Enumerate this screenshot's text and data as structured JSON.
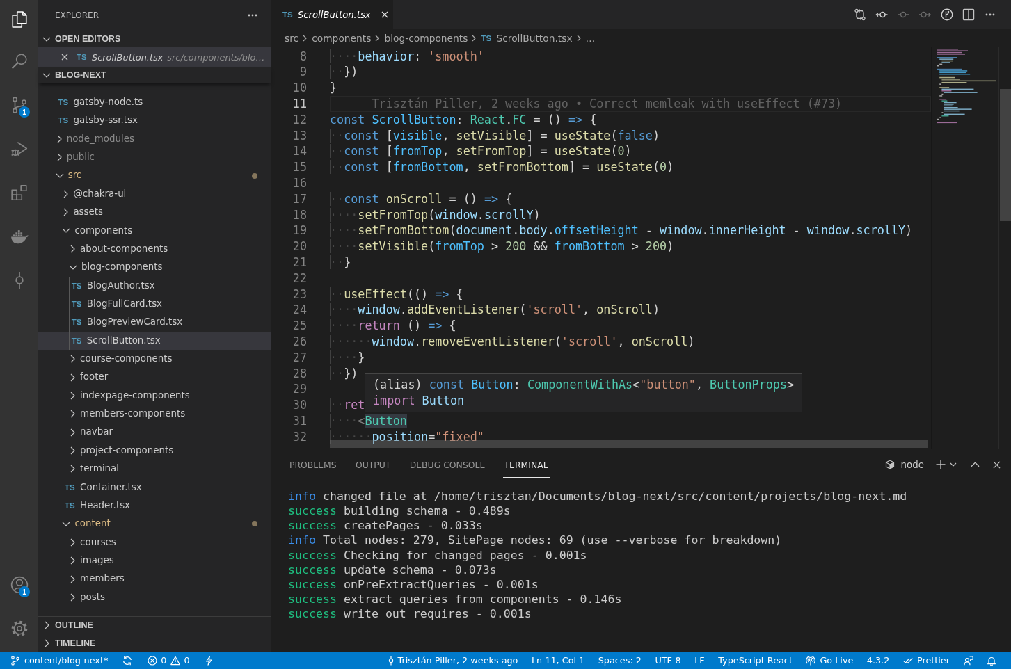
{
  "activity_bar": {
    "items": [
      {
        "selected": true
      },
      {
        "selected": false
      },
      {
        "selected": false,
        "badge": "1"
      },
      {
        "selected": false
      },
      {
        "selected": false
      },
      {
        "selected": false
      },
      {
        "selected": false
      }
    ],
    "accounts_badge": "1"
  },
  "sidebar": {
    "title": "EXPLORER",
    "open_editors": {
      "title": "OPEN EDITORS",
      "expanded": true,
      "items": [
        {
          "file_type": "TS",
          "name": "ScrollButton.tsx",
          "path": "src/components/blo…",
          "preview": true,
          "selected": true
        }
      ]
    },
    "folder": {
      "title": "BLOG-NEXT",
      "expanded": true,
      "tree": [
        {
          "kind": "file",
          "file_type": "TS",
          "name": "gatsby-node.ts",
          "selected": false,
          "ignored": false,
          "modified": false
        },
        {
          "kind": "file",
          "file_type": "TS",
          "name": "gatsby-ssr.tsx",
          "selected": false,
          "ignored": false,
          "modified": false
        },
        {
          "kind": "folder",
          "name": "node_modules",
          "expanded": false,
          "selected": false,
          "ignored": true,
          "modified": false
        },
        {
          "kind": "folder",
          "name": "public",
          "expanded": false,
          "selected": false,
          "ignored": true,
          "modified": false
        },
        {
          "kind": "folder",
          "name": "src",
          "expanded": true,
          "selected": false,
          "ignored": false,
          "modified": true,
          "children": [
            {
              "kind": "folder",
              "name": "@chakra-ui",
              "expanded": false,
              "selected": false,
              "ignored": false,
              "modified": false
            },
            {
              "kind": "folder",
              "name": "assets",
              "expanded": false,
              "selected": false,
              "ignored": false,
              "modified": false
            },
            {
              "kind": "folder",
              "name": "components",
              "expanded": true,
              "selected": false,
              "ignored": false,
              "modified": false,
              "children": [
                {
                  "kind": "folder",
                  "name": "about-components",
                  "expanded": false,
                  "selected": false,
                  "ignored": false,
                  "modified": false
                },
                {
                  "kind": "folder",
                  "name": "blog-components",
                  "expanded": true,
                  "selected": false,
                  "ignored": false,
                  "modified": false,
                  "children": [
                    {
                      "kind": "file",
                      "file_type": "TS",
                      "name": "BlogAuthor.tsx",
                      "selected": false,
                      "ignored": false,
                      "modified": false
                    },
                    {
                      "kind": "file",
                      "file_type": "TS",
                      "name": "BlogFullCard.tsx",
                      "selected": false,
                      "ignored": false,
                      "modified": false
                    },
                    {
                      "kind": "file",
                      "file_type": "TS",
                      "name": "BlogPreviewCard.tsx",
                      "selected": false,
                      "ignored": false,
                      "modified": false
                    },
                    {
                      "kind": "file",
                      "file_type": "TS",
                      "name": "ScrollButton.tsx",
                      "selected": true,
                      "ignored": false,
                      "modified": false
                    }
                  ]
                },
                {
                  "kind": "folder",
                  "name": "course-components",
                  "expanded": false,
                  "selected": false,
                  "ignored": false,
                  "modified": false
                },
                {
                  "kind": "folder",
                  "name": "footer",
                  "expanded": false,
                  "selected": false,
                  "ignored": false,
                  "modified": false
                },
                {
                  "kind": "folder",
                  "name": "indexpage-components",
                  "expanded": false,
                  "selected": false,
                  "ignored": false,
                  "modified": false
                },
                {
                  "kind": "folder",
                  "name": "members-components",
                  "expanded": false,
                  "selected": false,
                  "ignored": false,
                  "modified": false
                },
                {
                  "kind": "folder",
                  "name": "navbar",
                  "expanded": false,
                  "selected": false,
                  "ignored": false,
                  "modified": false
                },
                {
                  "kind": "folder",
                  "name": "project-components",
                  "expanded": false,
                  "selected": false,
                  "ignored": false,
                  "modified": false
                },
                {
                  "kind": "folder",
                  "name": "terminal",
                  "expanded": false,
                  "selected": false,
                  "ignored": false,
                  "modified": false
                },
                {
                  "kind": "file",
                  "file_type": "TS",
                  "name": "Container.tsx",
                  "selected": false,
                  "ignored": false,
                  "modified": false
                },
                {
                  "kind": "file",
                  "file_type": "TS",
                  "name": "Header.tsx",
                  "selected": false,
                  "ignored": false,
                  "modified": false
                }
              ]
            },
            {
              "kind": "folder",
              "name": "content",
              "expanded": true,
              "selected": false,
              "ignored": false,
              "modified": true,
              "children": [
                {
                  "kind": "folder",
                  "name": "courses",
                  "expanded": false,
                  "selected": false,
                  "ignored": false,
                  "modified": false
                },
                {
                  "kind": "folder",
                  "name": "images",
                  "expanded": false,
                  "selected": false,
                  "ignored": false,
                  "modified": false
                },
                {
                  "kind": "folder",
                  "name": "members",
                  "expanded": false,
                  "selected": false,
                  "ignored": false,
                  "modified": false
                },
                {
                  "kind": "folder",
                  "name": "posts",
                  "expanded": false,
                  "selected": false,
                  "ignored": false,
                  "modified": false
                }
              ]
            }
          ]
        }
      ]
    },
    "sections": [
      {
        "title": "OUTLINE",
        "expanded": false
      },
      {
        "title": "TIMELINE",
        "expanded": false
      }
    ]
  },
  "editor": {
    "tabs": [
      {
        "file_type": "TS",
        "name": "ScrollButton.tsx",
        "preview": true,
        "selected": true
      }
    ],
    "breadcrumbs": [
      {
        "name": "src"
      },
      {
        "name": "components"
      },
      {
        "name": "blog-components"
      },
      {
        "file_type": "TS",
        "name": "ScrollButton.tsx"
      },
      {
        "name": "…"
      }
    ],
    "lines": [
      {
        "number": "8",
        "current": false,
        "tokens": [
          {
            "kind": "ws",
            "text": "····"
          },
          {
            "kind": "var",
            "text": "behavior"
          },
          {
            "kind": "p",
            "text": ": "
          },
          {
            "kind": "str",
            "text": "'smooth'"
          }
        ]
      },
      {
        "number": "9",
        "current": false,
        "tokens": [
          {
            "kind": "ws",
            "text": "··"
          },
          {
            "kind": "p",
            "text": "})"
          }
        ]
      },
      {
        "number": "10",
        "current": false,
        "tokens": [
          {
            "kind": "p",
            "text": "}"
          }
        ]
      },
      {
        "number": "11",
        "current": true,
        "blame": "Trisztán Piller, 2 weeks ago • Correct memleak with useEffect (#73)"
      },
      {
        "number": "12",
        "current": false,
        "tokens": [
          {
            "kind": "kw",
            "text": "const "
          },
          {
            "kind": "const",
            "text": "ScrollButton"
          },
          {
            "kind": "p",
            "text": ": "
          },
          {
            "kind": "type",
            "text": "React"
          },
          {
            "kind": "p",
            "text": "."
          },
          {
            "kind": "type",
            "text": "FC"
          },
          {
            "kind": "p",
            "text": " = () "
          },
          {
            "kind": "kw",
            "text": "=>"
          },
          {
            "kind": "p",
            "text": " {"
          }
        ]
      },
      {
        "number": "13",
        "current": false,
        "tokens": [
          {
            "kind": "ws",
            "text": "··"
          },
          {
            "kind": "kw",
            "text": "const "
          },
          {
            "kind": "p",
            "text": "["
          },
          {
            "kind": "const",
            "text": "visible"
          },
          {
            "kind": "p",
            "text": ", "
          },
          {
            "kind": "fn",
            "text": "setVisible"
          },
          {
            "kind": "p",
            "text": "] = "
          },
          {
            "kind": "fn",
            "text": "useState"
          },
          {
            "kind": "p",
            "text": "("
          },
          {
            "kind": "kw",
            "text": "false"
          },
          {
            "kind": "p",
            "text": ")"
          }
        ]
      },
      {
        "number": "14",
        "current": false,
        "tokens": [
          {
            "kind": "ws",
            "text": "··"
          },
          {
            "kind": "kw",
            "text": "const "
          },
          {
            "kind": "p",
            "text": "["
          },
          {
            "kind": "const",
            "text": "fromTop"
          },
          {
            "kind": "p",
            "text": ", "
          },
          {
            "kind": "fn",
            "text": "setFromTop"
          },
          {
            "kind": "p",
            "text": "] = "
          },
          {
            "kind": "fn",
            "text": "useState"
          },
          {
            "kind": "p",
            "text": "("
          },
          {
            "kind": "num",
            "text": "0"
          },
          {
            "kind": "p",
            "text": ")"
          }
        ]
      },
      {
        "number": "15",
        "current": false,
        "tokens": [
          {
            "kind": "ws",
            "text": "··"
          },
          {
            "kind": "kw",
            "text": "const "
          },
          {
            "kind": "p",
            "text": "["
          },
          {
            "kind": "const",
            "text": "fromBottom"
          },
          {
            "kind": "p",
            "text": ", "
          },
          {
            "kind": "fn",
            "text": "setFromBottom"
          },
          {
            "kind": "p",
            "text": "] = "
          },
          {
            "kind": "fn",
            "text": "useState"
          },
          {
            "kind": "p",
            "text": "("
          },
          {
            "kind": "num",
            "text": "0"
          },
          {
            "kind": "p",
            "text": ")"
          }
        ]
      },
      {
        "number": "16",
        "current": false
      },
      {
        "number": "17",
        "current": false,
        "tokens": [
          {
            "kind": "ws",
            "text": "··"
          },
          {
            "kind": "kw",
            "text": "const "
          },
          {
            "kind": "fn",
            "text": "onScroll"
          },
          {
            "kind": "p",
            "text": " = () "
          },
          {
            "kind": "kw",
            "text": "=>"
          },
          {
            "kind": "p",
            "text": " {"
          }
        ]
      },
      {
        "number": "18",
        "current": false,
        "tokens": [
          {
            "kind": "ws",
            "text": "····"
          },
          {
            "kind": "fn",
            "text": "setFromTop"
          },
          {
            "kind": "p",
            "text": "("
          },
          {
            "kind": "var",
            "text": "window"
          },
          {
            "kind": "p",
            "text": "."
          },
          {
            "kind": "var",
            "text": "scrollY"
          },
          {
            "kind": "p",
            "text": ")"
          }
        ]
      },
      {
        "number": "19",
        "current": false,
        "tokens": [
          {
            "kind": "ws",
            "text": "····"
          },
          {
            "kind": "fn",
            "text": "setFromBottom"
          },
          {
            "kind": "p",
            "text": "("
          },
          {
            "kind": "var",
            "text": "document"
          },
          {
            "kind": "p",
            "text": "."
          },
          {
            "kind": "var",
            "text": "body"
          },
          {
            "kind": "p",
            "text": "."
          },
          {
            "kind": "const",
            "text": "offsetHeight"
          },
          {
            "kind": "p",
            "text": " - "
          },
          {
            "kind": "var",
            "text": "window"
          },
          {
            "kind": "p",
            "text": "."
          },
          {
            "kind": "var",
            "text": "innerHeight"
          },
          {
            "kind": "p",
            "text": " - "
          },
          {
            "kind": "var",
            "text": "window"
          },
          {
            "kind": "p",
            "text": "."
          },
          {
            "kind": "var",
            "text": "scrollY"
          },
          {
            "kind": "p",
            "text": ")"
          }
        ]
      },
      {
        "number": "20",
        "current": false,
        "tokens": [
          {
            "kind": "ws",
            "text": "····"
          },
          {
            "kind": "fn",
            "text": "setVisible"
          },
          {
            "kind": "p",
            "text": "("
          },
          {
            "kind": "const",
            "text": "fromTop"
          },
          {
            "kind": "p",
            "text": " > "
          },
          {
            "kind": "num",
            "text": "200"
          },
          {
            "kind": "p",
            "text": " && "
          },
          {
            "kind": "const",
            "text": "fromBottom"
          },
          {
            "kind": "p",
            "text": " > "
          },
          {
            "kind": "num",
            "text": "200"
          },
          {
            "kind": "p",
            "text": ")"
          }
        ]
      },
      {
        "number": "21",
        "current": false,
        "tokens": [
          {
            "kind": "ws",
            "text": "··"
          },
          {
            "kind": "p",
            "text": "}"
          }
        ]
      },
      {
        "number": "22",
        "current": false
      },
      {
        "number": "23",
        "current": false,
        "tokens": [
          {
            "kind": "ws",
            "text": "··"
          },
          {
            "kind": "fn",
            "text": "useEffect"
          },
          {
            "kind": "p",
            "text": "(() "
          },
          {
            "kind": "kw",
            "text": "=>"
          },
          {
            "kind": "p",
            "text": " {"
          }
        ]
      },
      {
        "number": "24",
        "current": false,
        "tokens": [
          {
            "kind": "ws",
            "text": "····"
          },
          {
            "kind": "var",
            "text": "window"
          },
          {
            "kind": "p",
            "text": "."
          },
          {
            "kind": "fn",
            "text": "addEventListener"
          },
          {
            "kind": "p",
            "text": "("
          },
          {
            "kind": "str",
            "text": "'scroll'"
          },
          {
            "kind": "p",
            "text": ", "
          },
          {
            "kind": "fn",
            "text": "onScroll"
          },
          {
            "kind": "p",
            "text": ")"
          }
        ]
      },
      {
        "number": "25",
        "current": false,
        "tokens": [
          {
            "kind": "ws",
            "text": "····"
          },
          {
            "kind": "ctrl",
            "text": "return"
          },
          {
            "kind": "p",
            "text": " () "
          },
          {
            "kind": "kw",
            "text": "=>"
          },
          {
            "kind": "p",
            "text": " {"
          }
        ]
      },
      {
        "number": "26",
        "current": false,
        "tokens": [
          {
            "kind": "ws",
            "text": "······"
          },
          {
            "kind": "var",
            "text": "window"
          },
          {
            "kind": "p",
            "text": "."
          },
          {
            "kind": "fn",
            "text": "removeEventListener"
          },
          {
            "kind": "p",
            "text": "("
          },
          {
            "kind": "str",
            "text": "'scroll'"
          },
          {
            "kind": "p",
            "text": ", "
          },
          {
            "kind": "fn",
            "text": "onScroll"
          },
          {
            "kind": "p",
            "text": ")"
          }
        ]
      },
      {
        "number": "27",
        "current": false,
        "tokens": [
          {
            "kind": "ws",
            "text": "····"
          },
          {
            "kind": "p",
            "text": "}"
          }
        ]
      },
      {
        "number": "28",
        "current": false,
        "tokens": [
          {
            "kind": "ws",
            "text": "··"
          },
          {
            "kind": "p",
            "text": "})"
          }
        ]
      },
      {
        "number": "29",
        "current": false
      },
      {
        "number": "30",
        "current": false,
        "tokens": [
          {
            "kind": "ws",
            "text": "··"
          },
          {
            "kind": "ctrl",
            "text": "ret"
          }
        ]
      },
      {
        "number": "31",
        "current": false,
        "tokens": [
          {
            "kind": "ws",
            "text": "····"
          },
          {
            "kind": "tagp",
            "text": "<"
          },
          {
            "kind": "type",
            "text": "Button",
            "highlighted": true
          }
        ]
      },
      {
        "number": "32",
        "current": false,
        "tokens": [
          {
            "kind": "ws",
            "text": "······"
          },
          {
            "kind": "var",
            "text": "position"
          },
          {
            "kind": "p",
            "text": "="
          },
          {
            "kind": "str",
            "text": "\"fixed\""
          }
        ]
      }
    ],
    "hover": {
      "lines": [
        {
          "tokens": [
            {
              "kind": "p",
              "text": "(alias) "
            },
            {
              "kind": "kw",
              "text": "const "
            },
            {
              "kind": "const",
              "text": "Button"
            },
            {
              "kind": "p",
              "text": ": "
            },
            {
              "kind": "type",
              "text": "ComponentWithAs"
            },
            {
              "kind": "p",
              "text": "<"
            },
            {
              "kind": "str",
              "text": "\"button\""
            },
            {
              "kind": "p",
              "text": ", "
            },
            {
              "kind": "type",
              "text": "ButtonProps"
            },
            {
              "kind": "p",
              "text": ">"
            }
          ]
        },
        {
          "tokens": [
            {
              "kind": "ctrl",
              "text": "import "
            },
            {
              "kind": "var",
              "text": "Button"
            }
          ]
        }
      ]
    }
  },
  "panel": {
    "tabs": [
      {
        "label": "PROBLEMS",
        "selected": false
      },
      {
        "label": "OUTPUT",
        "selected": false
      },
      {
        "label": "DEBUG CONSOLE",
        "selected": false
      },
      {
        "label": "TERMINAL",
        "selected": true
      }
    ],
    "terminal_name": "node",
    "output": [
      {
        "kind": "info",
        "prefix": "info",
        "text": "changed file at /home/trisztan/Documents/blog-next/src/content/projects/blog-next.md"
      },
      {
        "kind": "success",
        "prefix": "success",
        "text": "building schema - 0.489s"
      },
      {
        "kind": "success",
        "prefix": "success",
        "text": "createPages - 0.033s"
      },
      {
        "kind": "info",
        "prefix": "info",
        "text": "Total nodes: 279, SitePage nodes: 69 (use --verbose for breakdown)"
      },
      {
        "kind": "success",
        "prefix": "success",
        "text": "Checking for changed pages - 0.001s"
      },
      {
        "kind": "success",
        "prefix": "success",
        "text": "update schema - 0.073s"
      },
      {
        "kind": "success",
        "prefix": "success",
        "text": "onPreExtractQueries - 0.001s"
      },
      {
        "kind": "success",
        "prefix": "success",
        "text": "extract queries from components - 0.146s"
      },
      {
        "kind": "success",
        "prefix": "success",
        "text": "write out requires - 0.001s"
      }
    ]
  },
  "status_bar": {
    "branch": "content/blog-next*",
    "errors": "0",
    "warnings": "0",
    "blame": "Trisztán Piller, 2 weeks ago",
    "cursor": "Ln 11, Col 1",
    "indentation": "Spaces: 2",
    "encoding": "UTF-8",
    "line_ending": "LF",
    "language": "TypeScript React",
    "live_server": "Go Live",
    "version": "4.3.2",
    "formatter": "Prettier"
  }
}
